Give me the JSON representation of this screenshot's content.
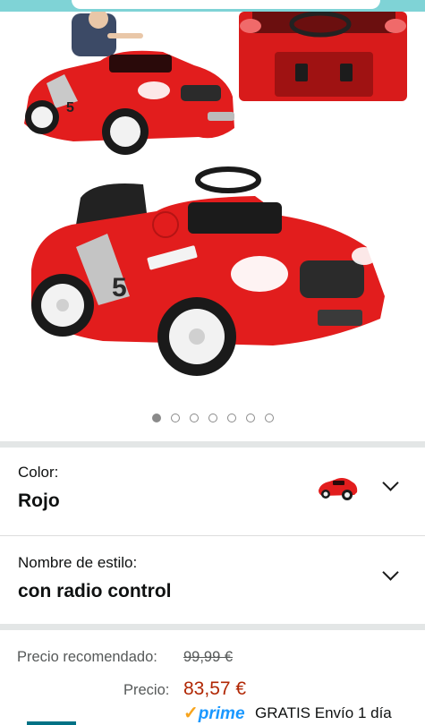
{
  "gallery": {
    "dot_count": 7,
    "active_index": 0,
    "images": [
      "car-with-child-photo",
      "car-interior-photo",
      "red-car-main-photo"
    ]
  },
  "color_selector": {
    "label": "Color:",
    "value": "Rojo"
  },
  "style_selector": {
    "label": "Nombre de estilo:",
    "value": "con radio control"
  },
  "pricing": {
    "rrp_label": "Precio recomendado:",
    "rrp_value": "99,99 €",
    "price_label": "Precio:",
    "price_value": "83,57 €",
    "prime_word": "prime",
    "prime_check": "✓",
    "shipping": "GRATIS Envío 1 día"
  },
  "colors": {
    "car_red": "#e21d1d",
    "price_red": "#b12704",
    "prime_blue": "#1a98ff",
    "prime_orange": "#f7a41d",
    "topbar_teal": "#7fd3d6"
  }
}
